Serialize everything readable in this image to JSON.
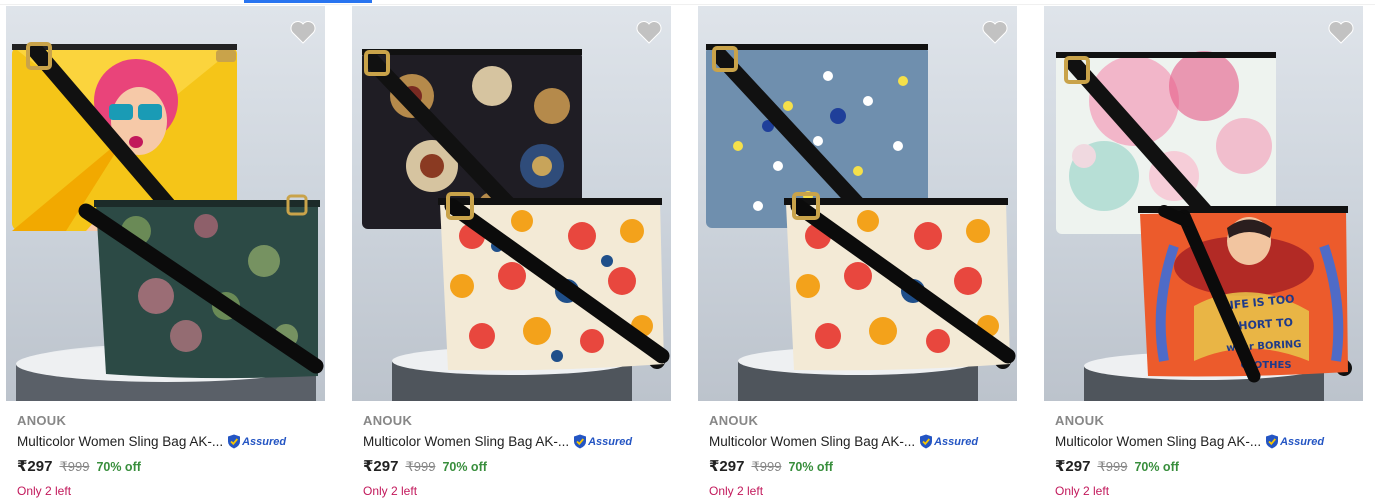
{
  "products": [
    {
      "brand": "ANOUK",
      "title": "Multicolor Women Sling Bag AK-...",
      "assured": "Assured",
      "price": "₹297",
      "mrp": "₹999",
      "discount": "70% off",
      "stock": "Only 2 left",
      "bag_back": "pop-art",
      "bag_front": "green-motif"
    },
    {
      "brand": "ANOUK",
      "title": "Multicolor Women Sling Bag AK-...",
      "assured": "Assured",
      "price": "₹297",
      "mrp": "₹999",
      "discount": "70% off",
      "stock": "Only 2 left",
      "bag_back": "batik-black",
      "bag_front": "floral-cream"
    },
    {
      "brand": "ANOUK",
      "title": "Multicolor Women Sling Bag AK-...",
      "assured": "Assured",
      "price": "₹297",
      "mrp": "₹999",
      "discount": "70% off",
      "stock": "Only 2 left",
      "bag_back": "blue-floral",
      "bag_front": "floral-cream"
    },
    {
      "brand": "ANOUK",
      "title": "Multicolor Women Sling Bag AK-...",
      "assured": "Assured",
      "price": "₹297",
      "mrp": "₹999",
      "discount": "70% off",
      "stock": "Only 2 left",
      "bag_back": "pink-watercolor",
      "bag_front": "orange-graphic",
      "bag_front_text": [
        "LIFE IS TOO",
        "SHORT TO",
        "wear BORING",
        "CLOTHES"
      ]
    }
  ],
  "colors": {
    "accent": "#2874f0",
    "discount": "#388e3c",
    "stock": "#c2185b",
    "assured": "#2455c3",
    "wishlist": "#c2c2c2"
  },
  "icons": {
    "wishlist": "heart-icon",
    "assured": "shield-check-icon"
  }
}
